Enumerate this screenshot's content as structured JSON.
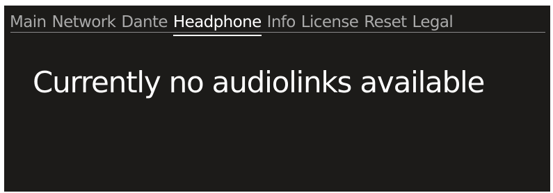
{
  "tabs": [
    {
      "label": "Main",
      "active": false
    },
    {
      "label": "Network",
      "active": false
    },
    {
      "label": "Dante",
      "active": false
    },
    {
      "label": "Headphone",
      "active": true
    },
    {
      "label": "Info",
      "active": false
    },
    {
      "label": "License",
      "active": false
    },
    {
      "label": "Reset",
      "active": false
    },
    {
      "label": "Legal",
      "active": false
    }
  ],
  "content": {
    "message": "Currently no audiolinks available"
  },
  "colors": {
    "background": "#1c1b19",
    "tab_inactive": "#a9a9a9",
    "tab_active": "#ffffff",
    "text": "#ffffff"
  }
}
